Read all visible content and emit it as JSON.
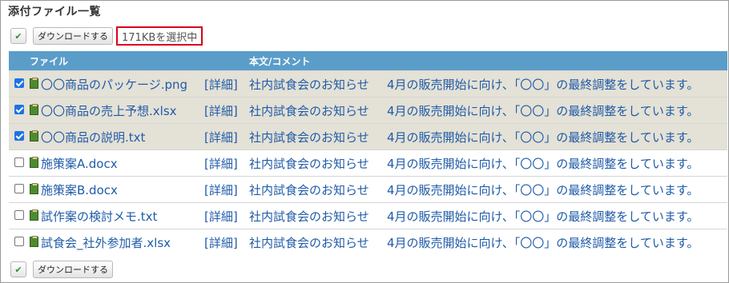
{
  "title": "添付ファイル一覧",
  "toolbar": {
    "download_label": "ダウンロードする",
    "selected_size": "171KBを選択中"
  },
  "table": {
    "columns": [
      "ファイル",
      "本文/コメント"
    ],
    "rows": [
      {
        "checked": true,
        "file_name": "〇〇商品のパッケージ.png",
        "detail": "[詳細]",
        "subject": "社内試食会のお知らせ",
        "body": "4月の販売開始に向け、「〇〇」の最終調整をしています。"
      },
      {
        "checked": true,
        "file_name": "〇〇商品の売上予想.xlsx",
        "detail": "[詳細]",
        "subject": "社内試食会のお知らせ",
        "body": "4月の販売開始に向け、「〇〇」の最終調整をしています。"
      },
      {
        "checked": true,
        "file_name": "〇〇商品の説明.txt",
        "detail": "[詳細]",
        "subject": "社内試食会のお知らせ",
        "body": "4月の販売開始に向け、「〇〇」の最終調整をしています。"
      },
      {
        "checked": false,
        "file_name": "施策案A.docx",
        "detail": "[詳細]",
        "subject": "社内試食会のお知らせ",
        "body": "4月の販売開始に向け、「〇〇」の最終調整をしています。"
      },
      {
        "checked": false,
        "file_name": "施策案B.docx",
        "detail": "[詳細]",
        "subject": "社内試食会のお知らせ",
        "body": "4月の販売開始に向け、「〇〇」の最終調整をしています。"
      },
      {
        "checked": false,
        "file_name": "試作案の検討メモ.txt",
        "detail": "[詳細]",
        "subject": "社内試食会のお知らせ",
        "body": "4月の販売開始に向け、「〇〇」の最終調整をしています。"
      },
      {
        "checked": false,
        "file_name": "試食会_社外参加者.xlsx",
        "detail": "[詳細]",
        "subject": "社内試食会のお知らせ",
        "body": "4月の販売開始に向け、「〇〇」の最終調整をしています。"
      }
    ]
  },
  "colors": {
    "header_bg": "#5b9dc9",
    "checked_row_bg": "#e4e1d6",
    "link_text": "#1f5ba8",
    "highlight_border": "#d9001c"
  }
}
